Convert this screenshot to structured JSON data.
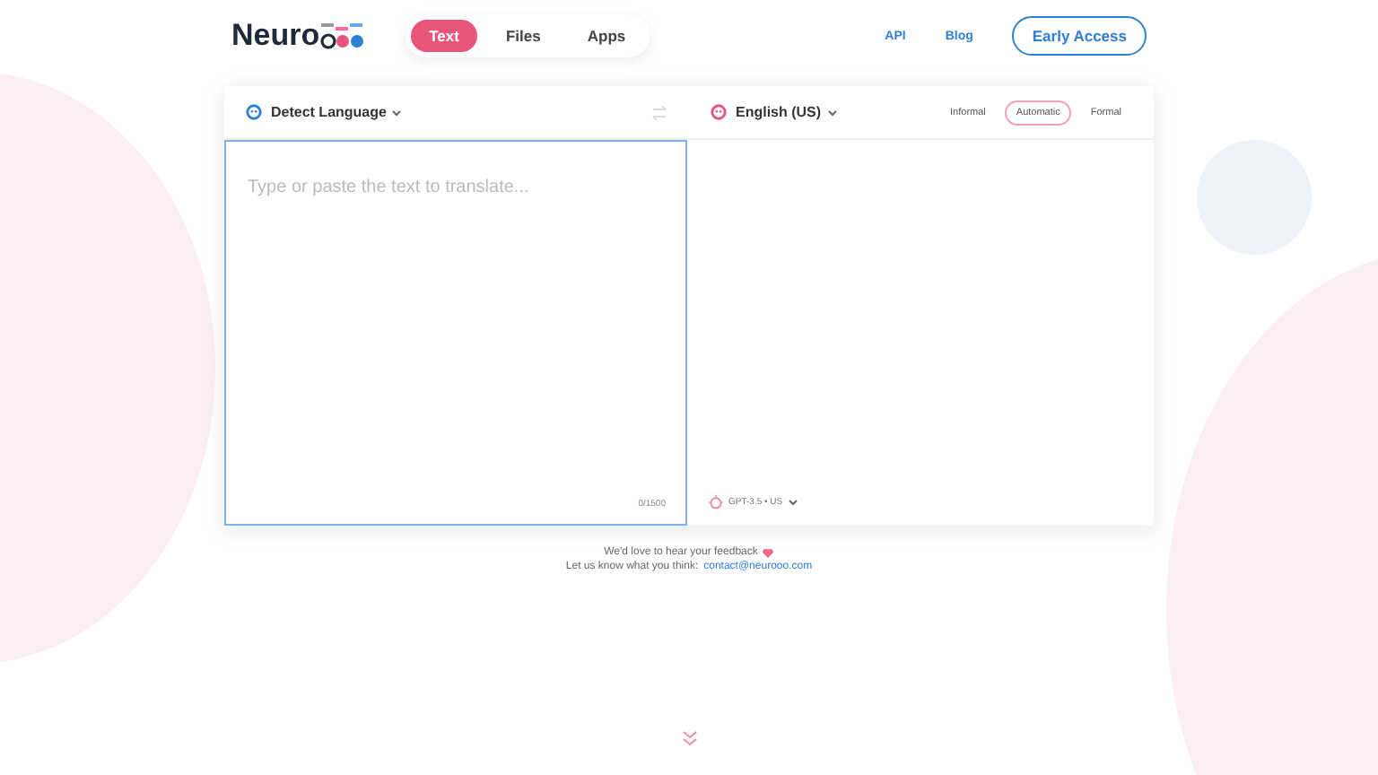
{
  "logo": {
    "text": "Neuro"
  },
  "tabs": [
    {
      "label": "Text",
      "selected": true
    },
    {
      "label": "Files",
      "selected": false
    },
    {
      "label": "Apps",
      "selected": false
    }
  ],
  "links": [
    "API",
    "Blog"
  ],
  "cta": "Early Access",
  "translator": {
    "source_language": "Detect Language",
    "target_language": "English (US)",
    "formality": [
      {
        "label": "Informal",
        "selected": false
      },
      {
        "label": "Automatic",
        "selected": true
      },
      {
        "label": "Formal",
        "selected": false
      }
    ],
    "input": {
      "placeholder": "Type or paste the text to translate..."
    },
    "char_count": "0/1500",
    "model": "GPT-3.5 • US"
  },
  "feedback": {
    "line": "We'd love to hear your feedback",
    "prompt": "Let us know what you think:",
    "email": "contact@neurooo.com"
  }
}
